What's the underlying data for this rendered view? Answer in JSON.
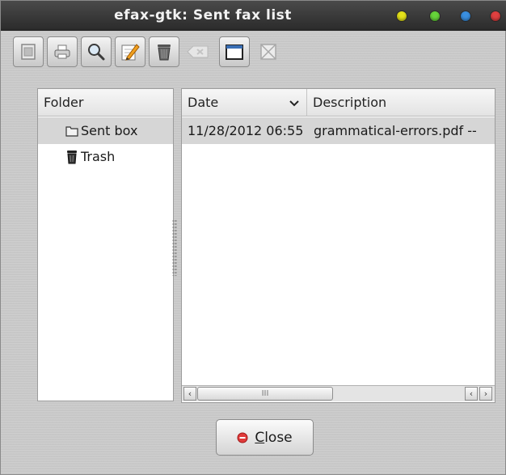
{
  "window": {
    "title": "efax-gtk: Sent fax list"
  },
  "titlebar_buttons": [
    {
      "name": "minimize",
      "color": "#e5e21a"
    },
    {
      "name": "maximize",
      "color": "#66d43a"
    },
    {
      "name": "shade",
      "color": "#3a8fe0"
    },
    {
      "name": "close",
      "color": "#e04040"
    }
  ],
  "toolbar": {
    "icons": [
      "view-icon",
      "print-icon",
      "describe-icon",
      "edit-description-icon",
      "delete-fax-icon",
      "empty-trash-icon",
      "new-folder-icon",
      "delete-folder-icon"
    ]
  },
  "folder_pane": {
    "header": "Folder",
    "items": [
      {
        "label": "Sent box",
        "icon": "folder-icon",
        "selected": true
      },
      {
        "label": "Trash",
        "icon": "trash-icon",
        "selected": false
      }
    ]
  },
  "fax_list": {
    "columns": {
      "date": "Date",
      "description": "Description"
    },
    "sort_indicator": "chevron-down-icon",
    "rows": [
      {
        "date": "11/28/2012 06:55",
        "description": "grammatical-errors.pdf --"
      }
    ]
  },
  "scrollbar": {
    "thumb_grip": "III"
  },
  "buttons": {
    "close_prefix": "",
    "close_mnemonic": "C",
    "close_rest": "lose"
  },
  "colors": {
    "selection": "#d6d6d6",
    "titlebar": "#333333"
  }
}
